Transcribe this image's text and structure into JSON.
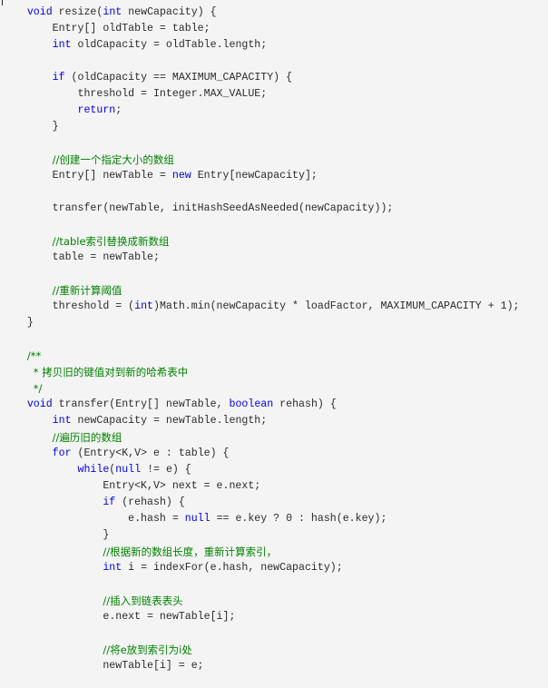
{
  "colors": {
    "background": "#f4f4f4",
    "text": "#2b2b2b",
    "keyword": "#0000e6",
    "comment": "#008200"
  },
  "code": {
    "language": "java",
    "lines": [
      [
        {
          "t": "    "
        },
        {
          "t": "void",
          "k": "kw"
        },
        {
          "t": " resize("
        },
        {
          "t": "int",
          "k": "kw"
        },
        {
          "t": " newCapacity) {"
        }
      ],
      [
        {
          "t": "        Entry[] oldTable = table;"
        }
      ],
      [
        {
          "t": "        "
        },
        {
          "t": "int",
          "k": "kw"
        },
        {
          "t": " oldCapacity = oldTable.length;"
        }
      ],
      [],
      [
        {
          "t": "        "
        },
        {
          "t": "if",
          "k": "kw"
        },
        {
          "t": " (oldCapacity == MAXIMUM_CAPACITY) {"
        }
      ],
      [
        {
          "t": "            threshold = Integer.MAX_VALUE;"
        }
      ],
      [
        {
          "t": "            "
        },
        {
          "t": "return",
          "k": "kw"
        },
        {
          "t": ";"
        }
      ],
      [
        {
          "t": "        }"
        }
      ],
      [],
      [
        {
          "t": "        "
        },
        {
          "t": "//创建一个指定大小的数组",
          "k": "cm"
        }
      ],
      [
        {
          "t": "        Entry[] newTable = "
        },
        {
          "t": "new",
          "k": "kw"
        },
        {
          "t": " Entry[newCapacity];"
        }
      ],
      [],
      [
        {
          "t": "        transfer(newTable, initHashSeedAsNeeded(newCapacity));"
        }
      ],
      [],
      [
        {
          "t": "        "
        },
        {
          "t": "//table索引替换成新数组",
          "k": "cm"
        }
      ],
      [
        {
          "t": "        table = newTable;"
        }
      ],
      [],
      [
        {
          "t": "        "
        },
        {
          "t": "//重新计算阈值",
          "k": "cm"
        }
      ],
      [
        {
          "t": "        threshold = ("
        },
        {
          "t": "int",
          "k": "kw"
        },
        {
          "t": ")Math.min(newCapacity * loadFactor, MAXIMUM_CAPACITY + 1);"
        }
      ],
      [
        {
          "t": "    }"
        }
      ],
      [],
      [
        {
          "t": "    "
        },
        {
          "t": "/**",
          "k": "cm"
        }
      ],
      [
        {
          "t": "     "
        },
        {
          "t": "* 拷贝旧的键值对到新的哈希表中",
          "k": "cm"
        }
      ],
      [
        {
          "t": "     "
        },
        {
          "t": "*/",
          "k": "cm"
        }
      ],
      [
        {
          "t": "    "
        },
        {
          "t": "void",
          "k": "kw"
        },
        {
          "t": " transfer(Entry[] newTable, "
        },
        {
          "t": "boolean",
          "k": "kw"
        },
        {
          "t": " rehash) {"
        }
      ],
      [
        {
          "t": "        "
        },
        {
          "t": "int",
          "k": "kw"
        },
        {
          "t": " newCapacity = newTable.length;"
        }
      ],
      [
        {
          "t": "        "
        },
        {
          "t": "//遍历旧的数组",
          "k": "cm"
        }
      ],
      [
        {
          "t": "        "
        },
        {
          "t": "for",
          "k": "kw"
        },
        {
          "t": " (Entry<K,V> e : table) {"
        }
      ],
      [
        {
          "t": "            "
        },
        {
          "t": "while",
          "k": "kw"
        },
        {
          "t": "("
        },
        {
          "t": "null",
          "k": "kw"
        },
        {
          "t": " != e) {"
        }
      ],
      [
        {
          "t": "                Entry<K,V> next = e.next;"
        }
      ],
      [
        {
          "t": "                "
        },
        {
          "t": "if",
          "k": "kw"
        },
        {
          "t": " (rehash) {"
        }
      ],
      [
        {
          "t": "                    e.hash = "
        },
        {
          "t": "null",
          "k": "kw"
        },
        {
          "t": " == e.key ? 0 : hash(e.key);"
        }
      ],
      [
        {
          "t": "                }"
        }
      ],
      [
        {
          "t": "                "
        },
        {
          "t": "//根据新的数组长度，重新计算索引，",
          "k": "cm"
        }
      ],
      [
        {
          "t": "                "
        },
        {
          "t": "int",
          "k": "kw"
        },
        {
          "t": " i = indexFor(e.hash, newCapacity);"
        }
      ],
      [],
      [
        {
          "t": "                "
        },
        {
          "t": "//插入到链表表头",
          "k": "cm"
        }
      ],
      [
        {
          "t": "                e.next = newTable[i];"
        }
      ],
      [],
      [
        {
          "t": "                "
        },
        {
          "t": "//将e放到索引为i处",
          "k": "cm"
        }
      ],
      [
        {
          "t": "                newTable[i] = e;"
        }
      ]
    ]
  }
}
